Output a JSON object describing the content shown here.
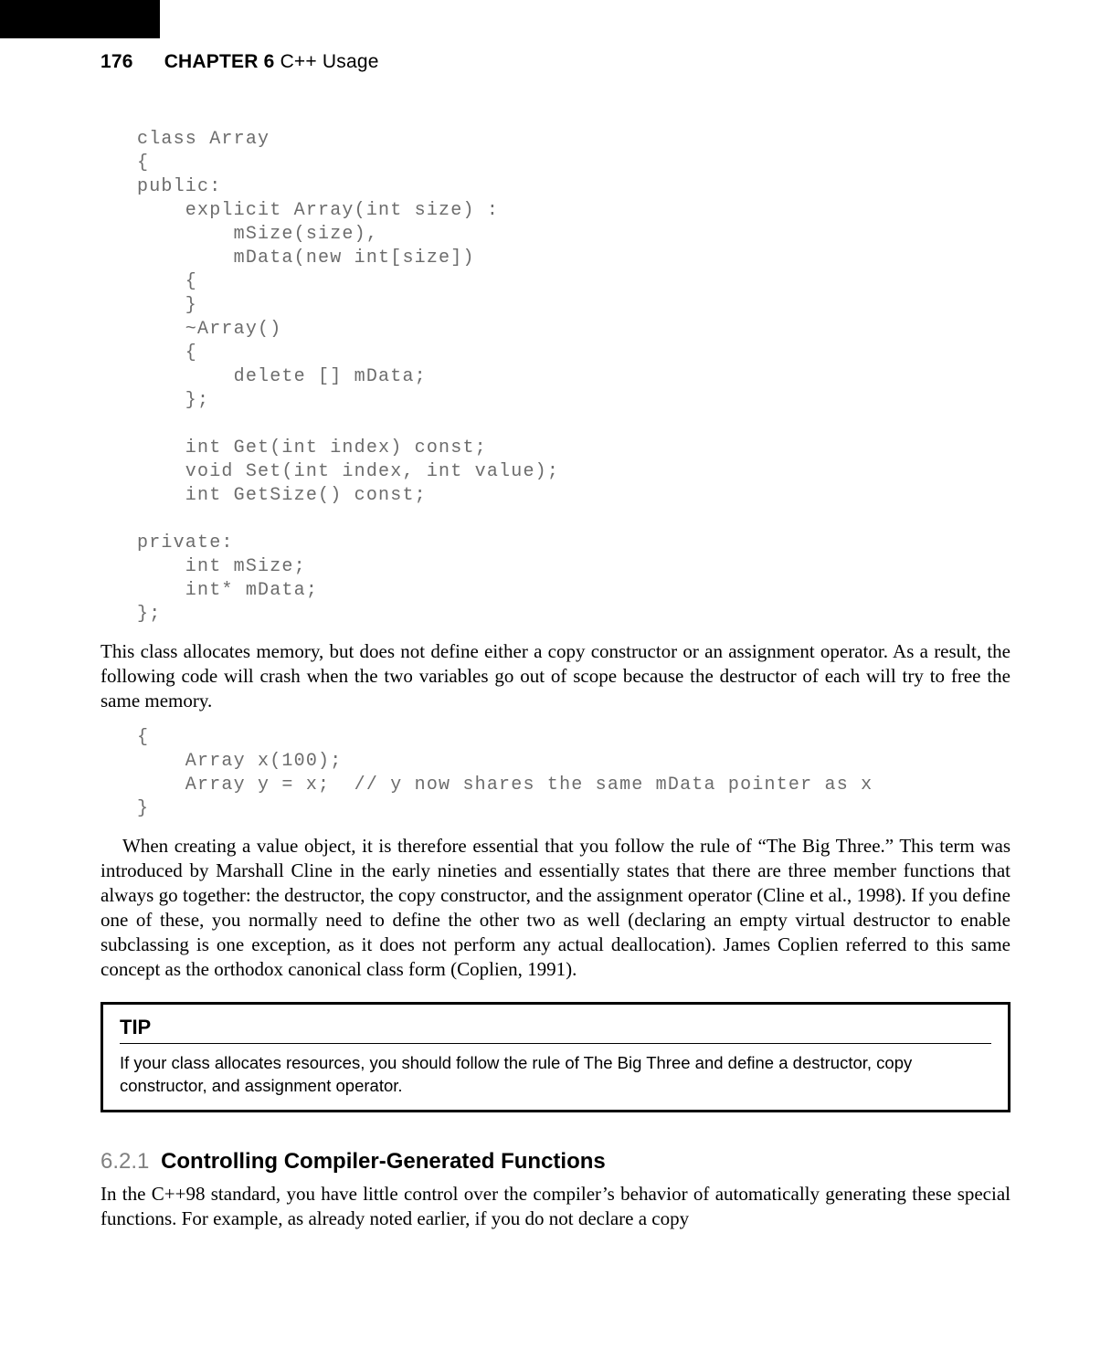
{
  "header": {
    "page_number": "176",
    "chapter_label": "CHAPTER 6",
    "chapter_title": "C++ Usage"
  },
  "code1": "class Array\n{\npublic:\n    explicit Array(int size) :\n        mSize(size),\n        mData(new int[size])\n    {\n    }\n    ~Array()\n    {\n        delete [] mData;\n    };\n\n    int Get(int index) const;\n    void Set(int index, int value);\n    int GetSize() const;\n\nprivate:\n    int mSize;\n    int* mData;\n};",
  "para1": "This class allocates memory, but does not define either a copy constructor or an assignment operator. As a result, the following code will crash when the two variables go out of scope because the destructor of each will try to free the same memory.",
  "code2": "{\n    Array x(100);\n    Array y = x;  // y now shares the same mData pointer as x\n}",
  "para2": "When creating a value object, it is therefore essential that you follow the rule of “The Big Three.” This term was introduced by Marshall Cline in the early nineties and essentially states that there are three member functions that always go together: the destructor, the copy constructor, and the assignment operator (Cline et al., 1998). If you define one of these, you normally need to define the other two as well (declaring an empty virtual destructor to enable subclassing is one exception, as it does not perform any actual deallocation). James Coplien referred to this same concept as the orthodox canonical class form (Coplien, 1991).",
  "tip": {
    "heading": "TIP",
    "body": "If your class allocates resources, you should follow the rule of The Big Three and define a destructor, copy constructor, and assignment operator."
  },
  "section": {
    "number": "6.2.1",
    "title": "Controlling Compiler-Generated Functions"
  },
  "para3": "In the C++98 standard, you have little control over the compiler’s behavior of automatically generating these special functions. For example, as already noted earlier, if you do not declare a copy"
}
